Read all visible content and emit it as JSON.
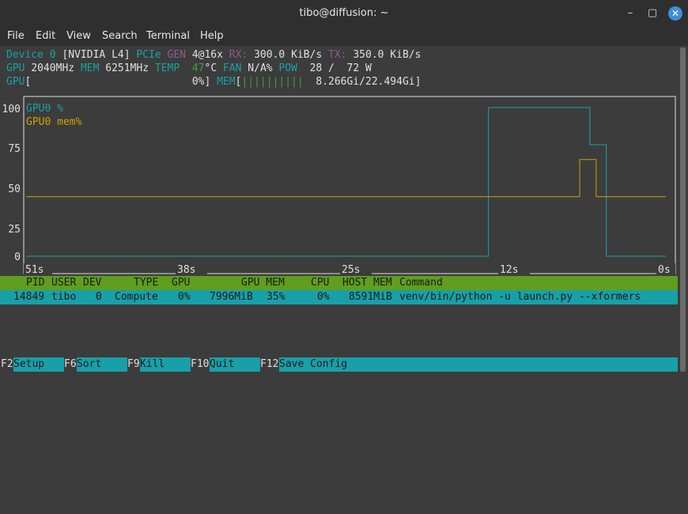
{
  "window": {
    "title": "tibo@diffusion: ~",
    "minimize": "–",
    "maximize": "▢",
    "close": "✕"
  },
  "menu": [
    "File",
    "Edit",
    "View",
    "Search",
    "Terminal",
    "Help"
  ],
  "info": {
    "device_label": "Device 0",
    "device_name": "[NVIDIA L4]",
    "pcie_label": "PCIe",
    "gen_label": "GEN",
    "gen_value": "4@16x",
    "rx_label": "RX:",
    "rx_value": "300.0 KiB/s",
    "tx_label": "TX:",
    "tx_value": "350.0 KiB/s",
    "gpu_label": "GPU",
    "gpu_clock": "2040MHz",
    "mem_label": "MEM",
    "mem_clock": "6251MHz",
    "temp_label": "TEMP",
    "temp_value": "47",
    "temp_unit": "°C",
    "fan_label": "FAN",
    "fan_value": "N/A%",
    "pow_label": "POW",
    "pow_value": "28 /  72 W",
    "gpu_bar_label": "GPU",
    "gpu_bar_open": "[",
    "gpu_bar_value": "0%]",
    "mem_bar_label": "MEM",
    "mem_bar_open": "[",
    "mem_bar_fill": "||||||||||",
    "mem_bar_value": "8.266Gi/22.494Gi]",
    "mem_fraction": 0.367
  },
  "chart_data": {
    "type": "line",
    "x_tick_labels": [
      "51s",
      "38s",
      "25s",
      "12s",
      "0s"
    ],
    "y_tick_labels": [
      "100",
      "75",
      "50",
      "25",
      "0"
    ],
    "ylim": [
      0,
      100
    ],
    "xlim": [
      -51,
      0
    ],
    "series": [
      {
        "name": "GPU0 %",
        "color": "#17a2a8",
        "x": [
          -51,
          -14.5,
          -14.5,
          -6.5,
          -6.5,
          -5.2,
          -5.2,
          -0.5
        ],
        "y": [
          0,
          0,
          100,
          100,
          75,
          75,
          0,
          0
        ]
      },
      {
        "name": "GPU0 mem%",
        "color": "#d1a000",
        "x": [
          -51,
          -7.3,
          -7.3,
          -6.0,
          -6.0,
          -0.5
        ],
        "y": [
          40,
          40,
          65,
          65,
          40,
          40
        ]
      }
    ],
    "grid": false,
    "legend_position": "top-left"
  },
  "table": {
    "headers": [
      "PID",
      "USER",
      "DEV",
      "TYPE",
      "GPU",
      "GPU MEM",
      "CPU",
      "HOST MEM",
      "Command"
    ],
    "rows": [
      [
        "14849",
        "tibo",
        "0",
        "Compute",
        "0%",
        "7996MiB",
        "35%",
        "0%",
        "8591MiB",
        "venv/bin/python -u launch.py --xformers"
      ]
    ]
  },
  "footer": [
    {
      "key": "F2",
      "label": "Setup"
    },
    {
      "key": "F6",
      "label": "Sort"
    },
    {
      "key": "F9",
      "label": "Kill"
    },
    {
      "key": "F10",
      "label": "Quit"
    },
    {
      "key": "F12",
      "label": "Save Config"
    }
  ]
}
